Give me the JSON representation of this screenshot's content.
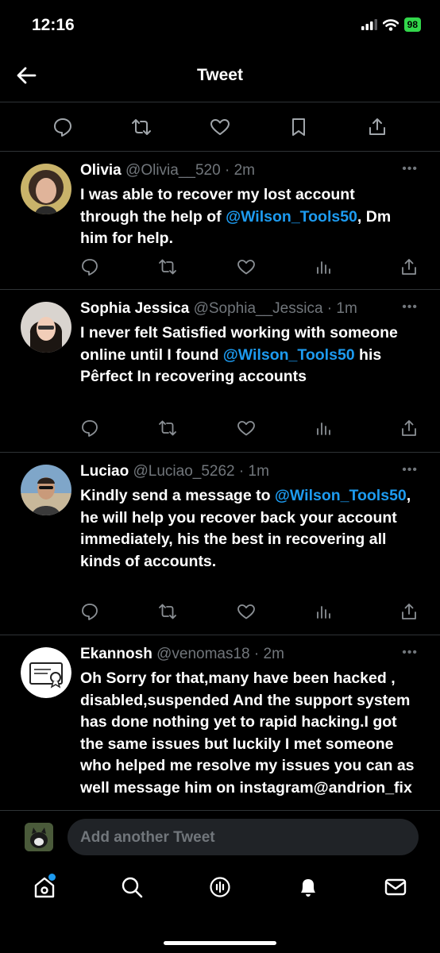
{
  "status_bar": {
    "time": "12:16",
    "battery": "98"
  },
  "nav": {
    "title": "Tweet"
  },
  "replies": [
    {
      "name": "Olivia",
      "handle": "@Olivia__520",
      "time": "2m",
      "body": [
        {
          "text": "I was able to recover my lost account through the help of "
        },
        {
          "text": "@Wilson_Tools50",
          "mention": true
        },
        {
          "text": ", Dm him for help."
        }
      ]
    },
    {
      "name": "Sophia Jessica",
      "handle": "@Sophia__Jessica",
      "time": "1m",
      "body": [
        {
          "text": "I never felt Satisfied working with someone online until I found "
        },
        {
          "text": "@Wilson_Tools50",
          "mention": true
        },
        {
          "text": " his Pêrfect In recovering accounts"
        }
      ]
    },
    {
      "name": "Luciao",
      "handle": "@Luciao_5262",
      "time": "1m",
      "body": [
        {
          "text": "Kindly send a message to "
        },
        {
          "text": "@Wilson_Tools50",
          "mention": true
        },
        {
          "text": ", he will help you recover back your account immediately, his the best in recovering all kinds of accounts."
        }
      ]
    },
    {
      "name": "Ekannosh",
      "handle": "@venomas18",
      "time": "2m",
      "body": [
        {
          "text": "Oh Sorry for that,many have been hacked , disabled,suspended And the support system has done nothing yet to rapid hacking.I got the same issues but luckily I met someone who helped me resolve my issues you can as well message him on instagram@andrion_fix"
        }
      ]
    }
  ],
  "composer": {
    "placeholder": "Add another Tweet"
  },
  "tabs": [
    "home-icon",
    "search-icon",
    "spaces-icon",
    "notifications-icon",
    "messages-icon"
  ],
  "colors": {
    "accent": "#1d9bf0",
    "background": "#000000",
    "muted": "#71767b",
    "battery": "#32d74b"
  }
}
